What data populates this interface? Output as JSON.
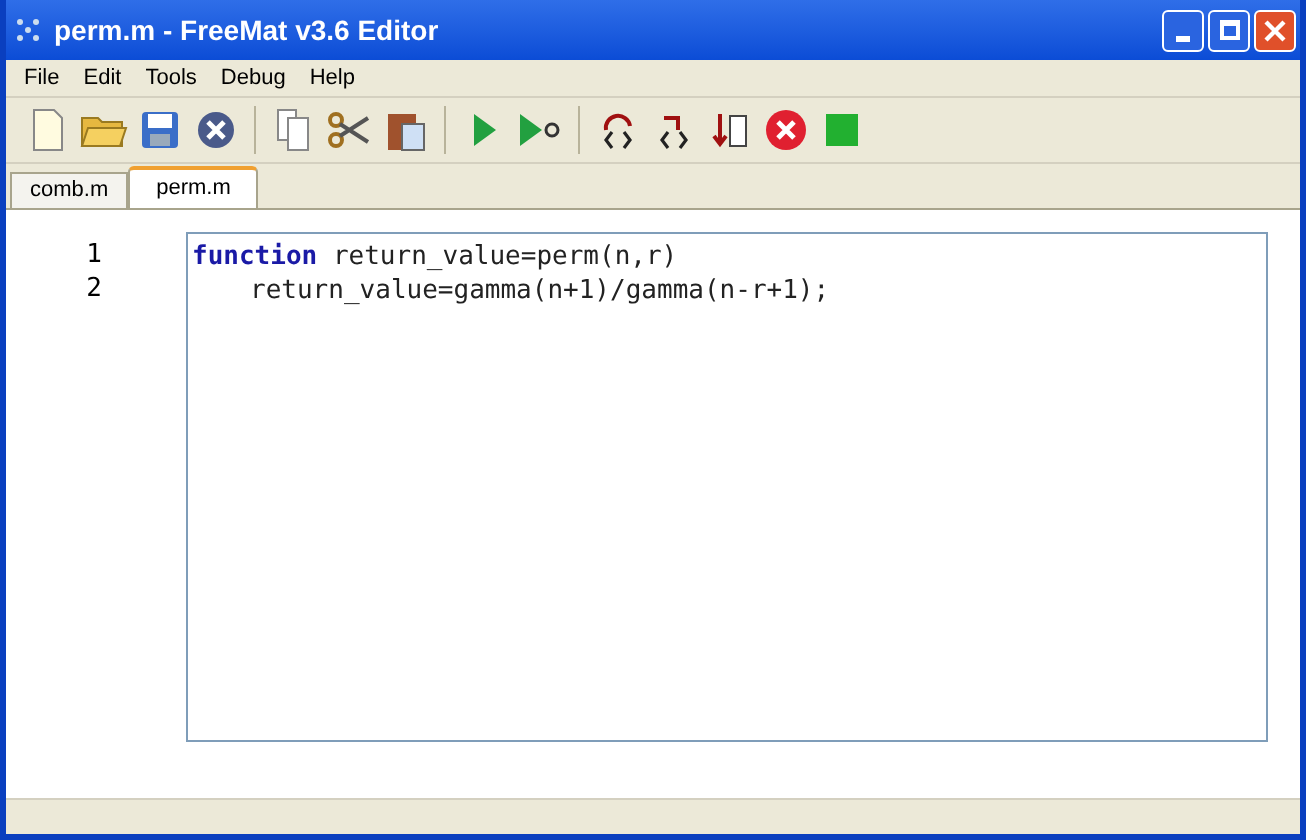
{
  "window": {
    "title": "perm.m - FreeMat v3.6 Editor"
  },
  "menu": [
    "File",
    "Edit",
    "Tools",
    "Debug",
    "Help"
  ],
  "tabs": [
    {
      "label": "comb.m",
      "selected": false
    },
    {
      "label": "perm.m",
      "selected": true
    }
  ],
  "editor": {
    "lines": [
      {
        "number": "1",
        "indented": false,
        "segments": [
          {
            "text": "function",
            "kind": "keyword"
          },
          {
            "text": " return_value=perm(n,r)",
            "kind": "plain"
          }
        ]
      },
      {
        "number": "2",
        "indented": true,
        "segments": [
          {
            "text": "return_value=gamma(n+1)/gamma(n-r+1);",
            "kind": "plain"
          }
        ]
      }
    ]
  }
}
